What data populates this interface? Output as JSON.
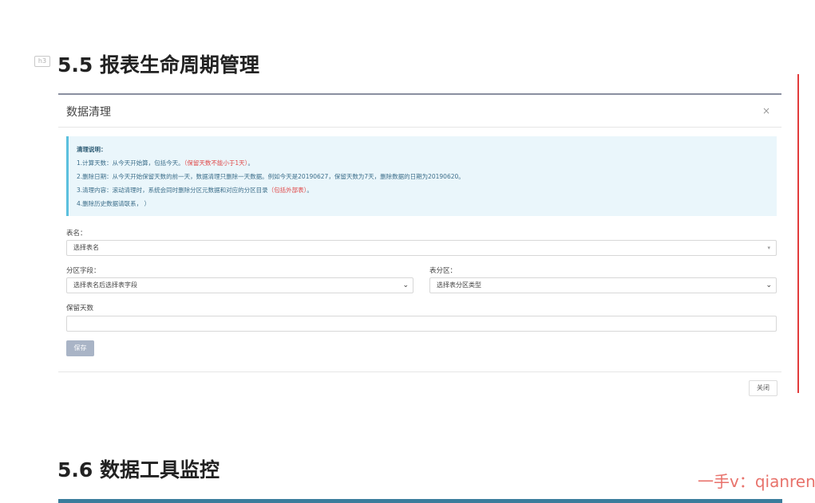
{
  "doc": {
    "heading_badge": "h3",
    "section_55_title": "5.5 报表生命周期管理",
    "section_56_title": "5.6 数据工具监控",
    "watermark": "一手v：qianren"
  },
  "modal": {
    "title": "数据清理",
    "close_symbol": "×",
    "info": {
      "title": "清理说明：",
      "line1_text": "1.计算天数：从今天开始算，包括今天。",
      "line1_highlight": "（保留天数不能小于1天）",
      "line1_end": "。",
      "line2": "2.删除日期：从今天开始保留天数的前一天，数据清理只删除一天数据。例如今天是20190627，保留天数为7天，删除数据的日期为20190620。",
      "line3_text": "3.清理内容：滚动清理时，系统会同时删除分区元数据和对应的分区目录",
      "line3_highlight": "（包括外部表）",
      "line3_end": "。",
      "line4": "4.删除历史数据请联系，                              ）"
    },
    "form": {
      "table_label": "表名：",
      "table_placeholder": "选择表名",
      "partition_field_label": "分区字段：",
      "partition_field_placeholder": "选择表名后选择表字段",
      "table_partition_label": "表分区：",
      "table_partition_placeholder": "选择表分区类型",
      "retention_label": "保留天数",
      "retention_value": ""
    },
    "save_label": "保存",
    "close_label": "关闭"
  },
  "colors": {
    "accent_red": "#e23b3b",
    "info_bg": "#eaf6fb",
    "info_border": "#5bc0de",
    "save_button": "#a9b4c6",
    "bottom_bar": "#3b7d9c",
    "watermark": "#e8726b"
  }
}
